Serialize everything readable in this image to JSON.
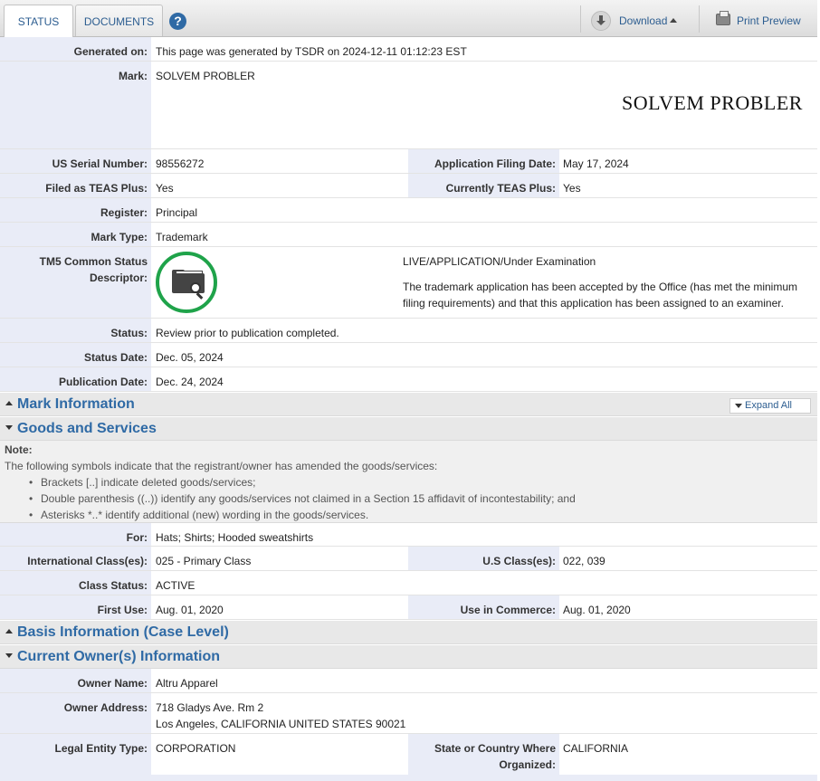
{
  "toolbar": {
    "tabs": [
      "STATUS",
      "DOCUMENTS"
    ],
    "help": "?",
    "download": "Download",
    "print_preview": "Print Preview"
  },
  "generated_on": {
    "label": "Generated on:",
    "value": "This page was generated by TSDR on 2024-12-11 01:12:23 EST"
  },
  "mark": {
    "label": "Mark:",
    "value": "SOLVEM PROBLER",
    "image_text": "SOLVEM PROBLER"
  },
  "serial": {
    "label": "US Serial Number:",
    "value": "98556272"
  },
  "filing_date": {
    "label": "Application Filing Date:",
    "value": "May 17, 2024"
  },
  "teas_plus": {
    "label": "Filed as TEAS Plus:",
    "value": "Yes"
  },
  "current_teas": {
    "label": "Currently TEAS Plus:",
    "value": "Yes"
  },
  "register": {
    "label": "Register:",
    "value": "Principal"
  },
  "mark_type": {
    "label": "Mark Type:",
    "value": "Trademark"
  },
  "tm5": {
    "label1": "TM5 Common Status",
    "label2": "Descriptor:",
    "status": "LIVE/APPLICATION/Under Examination",
    "desc1": "The trademark application has been accepted by the Office (has met the minimum",
    "desc2": "filing requirements) and that this application has been assigned to an examiner.",
    "icon": "folder-search-icon",
    "ring_color": "#1fa34a"
  },
  "status": {
    "label": "Status:",
    "value": "Review prior to publication completed."
  },
  "status_date": {
    "label": "Status Date:",
    "value": "Dec. 05, 2024"
  },
  "publication_date": {
    "label": "Publication Date:",
    "value": "Dec. 24, 2024"
  },
  "sections": {
    "mark_info": "Mark Information",
    "expand_all": "Expand All",
    "goods": "Goods and Services",
    "basis": "Basis Information (Case Level)",
    "owner": "Current Owner(s) Information"
  },
  "note": {
    "heading": "Note:",
    "intro": "The following symbols indicate that the registrant/owner has amended the goods/services:",
    "items": [
      "Brackets [..] indicate deleted goods/services;",
      "Double parenthesis ((..)) identify any goods/services not claimed in a Section 15 affidavit of incontestability; and",
      "Asterisks *..* identify additional (new) wording in the goods/services."
    ]
  },
  "goods": {
    "for": {
      "label": "For:",
      "value": "Hats; Shirts; Hooded sweatshirts"
    },
    "intl_class": {
      "label": "International Class(es):",
      "value": "025 - Primary Class"
    },
    "us_class": {
      "label": "U.S Class(es):",
      "value": "022, 039"
    },
    "class_status": {
      "label": "Class Status:",
      "value": "ACTIVE"
    },
    "first_use": {
      "label": "First Use:",
      "value": "Aug. 01, 2020"
    },
    "use_commerce": {
      "label": "Use in Commerce:",
      "value": "Aug. 01, 2020"
    }
  },
  "owner": {
    "name": {
      "label": "Owner Name:",
      "value": "Altru Apparel"
    },
    "address": {
      "label": "Owner Address:",
      "line1": "718 Gladys Ave. Rm 2",
      "line2": "Los Angeles, CALIFORNIA UNITED STATES 90021"
    },
    "entity": {
      "label": "Legal Entity Type:",
      "value": "CORPORATION"
    },
    "state": {
      "label1": "State or Country Where",
      "label2": "Organized:",
      "value": "CALIFORNIA"
    }
  },
  "colors": {
    "accent": "#2f6aa5",
    "label_bg": "#e9ecf7",
    "section_bg": "#e8e8e8"
  }
}
